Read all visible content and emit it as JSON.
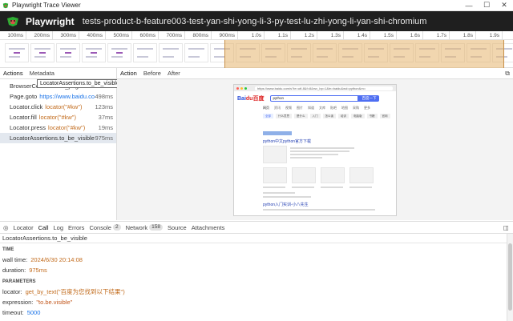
{
  "window": {
    "title": "Playwright Trace Viewer",
    "controls": [
      "—",
      "☐",
      "✕"
    ]
  },
  "app": {
    "name": "Playwright",
    "title": "tests-product-b-feature003-test-yan-shi-yong-li-3-py-test-lu-zhi-yong-li-yan-shi-chromium"
  },
  "timeline": {
    "ticks": [
      "100ms",
      "200ms",
      "300ms",
      "400ms",
      "500ms",
      "600ms",
      "700ms",
      "800ms",
      "900ms",
      "1.0s",
      "1.1s",
      "1.2s",
      "1.3s",
      "1.4s",
      "1.5s",
      "1.6s",
      "1.7s",
      "1.8s",
      "1.9s"
    ]
  },
  "left_tabs": [
    "Actions",
    "Metadata"
  ],
  "actions": [
    {
      "name": "BrowserContext.new_page",
      "locator": "",
      "link": "",
      "duration": "49ms"
    },
    {
      "name": "Page.goto",
      "locator": "",
      "link": "https://www.baidu.com/",
      "duration": "498ms"
    },
    {
      "name": "Locator.click",
      "locator": "locator(\"#kw\")",
      "link": "",
      "duration": "123ms"
    },
    {
      "name": "Locator.fill",
      "locator": "locator(\"#kw\")",
      "link": "",
      "duration": "37ms"
    },
    {
      "name": "Locator.press",
      "locator": "locator(\"#kw\")",
      "link": "",
      "duration": "19ms"
    },
    {
      "name": "LocatorAssertions.to_be_visible",
      "locator": "",
      "link": "",
      "duration": "975ms"
    }
  ],
  "tooltip": "LocatorAssertions.to_be_visible",
  "snapshot_tabs": [
    "Action",
    "Before",
    "After"
  ],
  "snapshot": {
    "url": "https://www.baidu.com/s?ie=utf-8&f=8&rsv_bp=1&tn=baidu&wd=python&rn=",
    "logo": "Bai",
    "logo_red": "du百度",
    "search_value": "python",
    "search_button": "百度一下",
    "nav": [
      "网页",
      "资讯",
      "视频",
      "图片",
      "知道",
      "文库",
      "贴吧",
      "地图",
      "采购",
      "更多"
    ],
    "filters": [
      "全部",
      "什么意思",
      "是什么",
      "入门",
      "怎么读",
      "培训",
      "电脑版",
      "书籍",
      "官网"
    ],
    "result1_title": "python中文python官方下载",
    "result2_title": "python入门实训-小八先生"
  },
  "bottom_tabs": [
    {
      "label": "Locator",
      "badge": ""
    },
    {
      "label": "Call",
      "badge": ""
    },
    {
      "label": "Log",
      "badge": ""
    },
    {
      "label": "Errors",
      "badge": ""
    },
    {
      "label": "Console",
      "badge": "2"
    },
    {
      "label": "Network",
      "badge": "158"
    },
    {
      "label": "Source",
      "badge": ""
    },
    {
      "label": "Attachments",
      "badge": ""
    }
  ],
  "details": {
    "header": "LocatorAssertions.to_be_visible",
    "time_section": "TIME",
    "wall_time_label": "wall time:",
    "wall_time": "2024/6/30 20:14:08",
    "duration_label": "duration:",
    "duration": "975ms",
    "params_section": "PARAMETERS",
    "locator_label": "locator:",
    "locator": "get_by_text(\"百度为您找到以下结果\")",
    "expression_label": "expression:",
    "expression": "\"to.be.visible\"",
    "timeout_label": "timeout:",
    "timeout": "5000"
  },
  "colors": {
    "accent": "#1a73e8",
    "locator": "#c26b1c",
    "selection": "#e6b46e",
    "header_bg": "#1f1f1f"
  }
}
